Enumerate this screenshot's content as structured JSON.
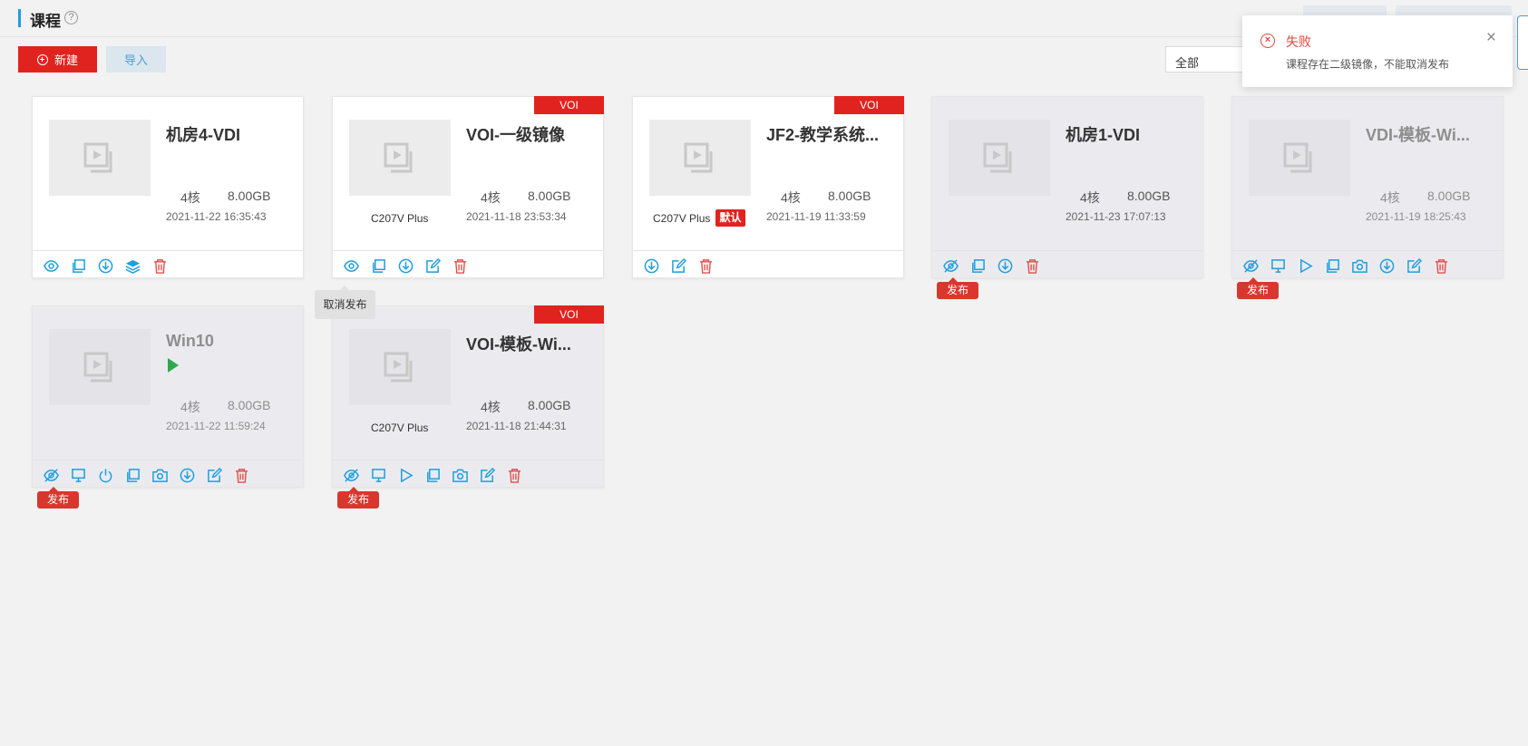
{
  "header": {
    "title": "课程",
    "help_icon": "?"
  },
  "toolbar": {
    "new_label": "新建",
    "import_label": "导入"
  },
  "filter": {
    "selected": "全部"
  },
  "toast": {
    "title": "失败",
    "message": "课程存在二级镜像，不能取消发布",
    "close_label": "×",
    "icon": "close-circle-icon"
  },
  "tooltip": {
    "text": "取消发布"
  },
  "colors": {
    "accent": "#1e9fe0",
    "danger": "#e1231f",
    "running": "#2fa84f",
    "action_icon": "#1e9fe0",
    "delete_icon": "#e0504a"
  },
  "cards": [
    {
      "name": "机房4-VDI",
      "cores": "4核",
      "memory": "8.00GB",
      "date": "2021-11-22 16:35:43",
      "model": "",
      "voi": "",
      "default": "",
      "running": false,
      "published": true,
      "actions": [
        "eye-icon",
        "copy-icon",
        "download-icon",
        "layers-icon",
        "delete-icon"
      ]
    },
    {
      "name": "VOI-一级镜像",
      "cores": "4核",
      "memory": "8.00GB",
      "date": "2021-11-18 23:53:34",
      "model": "C207V Plus",
      "voi": "VOI",
      "default": "",
      "running": false,
      "published": true,
      "actions": [
        "eye-icon",
        "copy-icon",
        "download-icon",
        "edit-icon",
        "delete-icon"
      ]
    },
    {
      "name": "JF2-教学系统...",
      "cores": "4核",
      "memory": "8.00GB",
      "date": "2021-11-19 11:33:59",
      "model": "C207V Plus",
      "voi": "VOI",
      "default": "默认",
      "running": false,
      "published": true,
      "actions": [
        "download-icon",
        "edit-icon",
        "delete-icon"
      ]
    },
    {
      "name": "机房1-VDI",
      "cores": "4核",
      "memory": "8.00GB",
      "date": "2021-11-23 17:07:13",
      "model": "",
      "voi": "",
      "default": "",
      "running": false,
      "published": false,
      "publish_tag": "发布",
      "actions": [
        "eye-off-icon",
        "copy-icon",
        "download-icon",
        "delete-icon"
      ]
    },
    {
      "name": "VDI-模板-Wi...",
      "cores": "4核",
      "memory": "8.00GB",
      "date": "2021-11-19 18:25:43",
      "model": "",
      "voi": "",
      "default": "",
      "running": false,
      "published": false,
      "publish_tag": "发布",
      "actions": [
        "eye-off-icon",
        "monitor-icon",
        "play-icon",
        "copy-icon",
        "camera-icon",
        "download-icon",
        "edit-icon",
        "delete-icon"
      ]
    },
    {
      "name": "Win10",
      "cores": "4核",
      "memory": "8.00GB",
      "date": "2021-11-22 11:59:24",
      "model": "",
      "voi": "",
      "default": "",
      "running": true,
      "published": false,
      "publish_tag": "发布",
      "actions": [
        "eye-off-icon",
        "monitor-icon",
        "power-icon",
        "copy-icon",
        "camera-icon",
        "download-icon",
        "edit-icon",
        "delete-icon"
      ]
    },
    {
      "name": "VOI-模板-Wi...",
      "cores": "4核",
      "memory": "8.00GB",
      "date": "2021-11-18 21:44:31",
      "model": "C207V Plus",
      "voi": "VOI",
      "default": "",
      "running": false,
      "published": false,
      "publish_tag": "发布",
      "actions": [
        "eye-off-icon",
        "monitor-icon",
        "play-icon",
        "copy-icon",
        "camera-icon",
        "edit-icon",
        "delete-icon"
      ]
    }
  ]
}
